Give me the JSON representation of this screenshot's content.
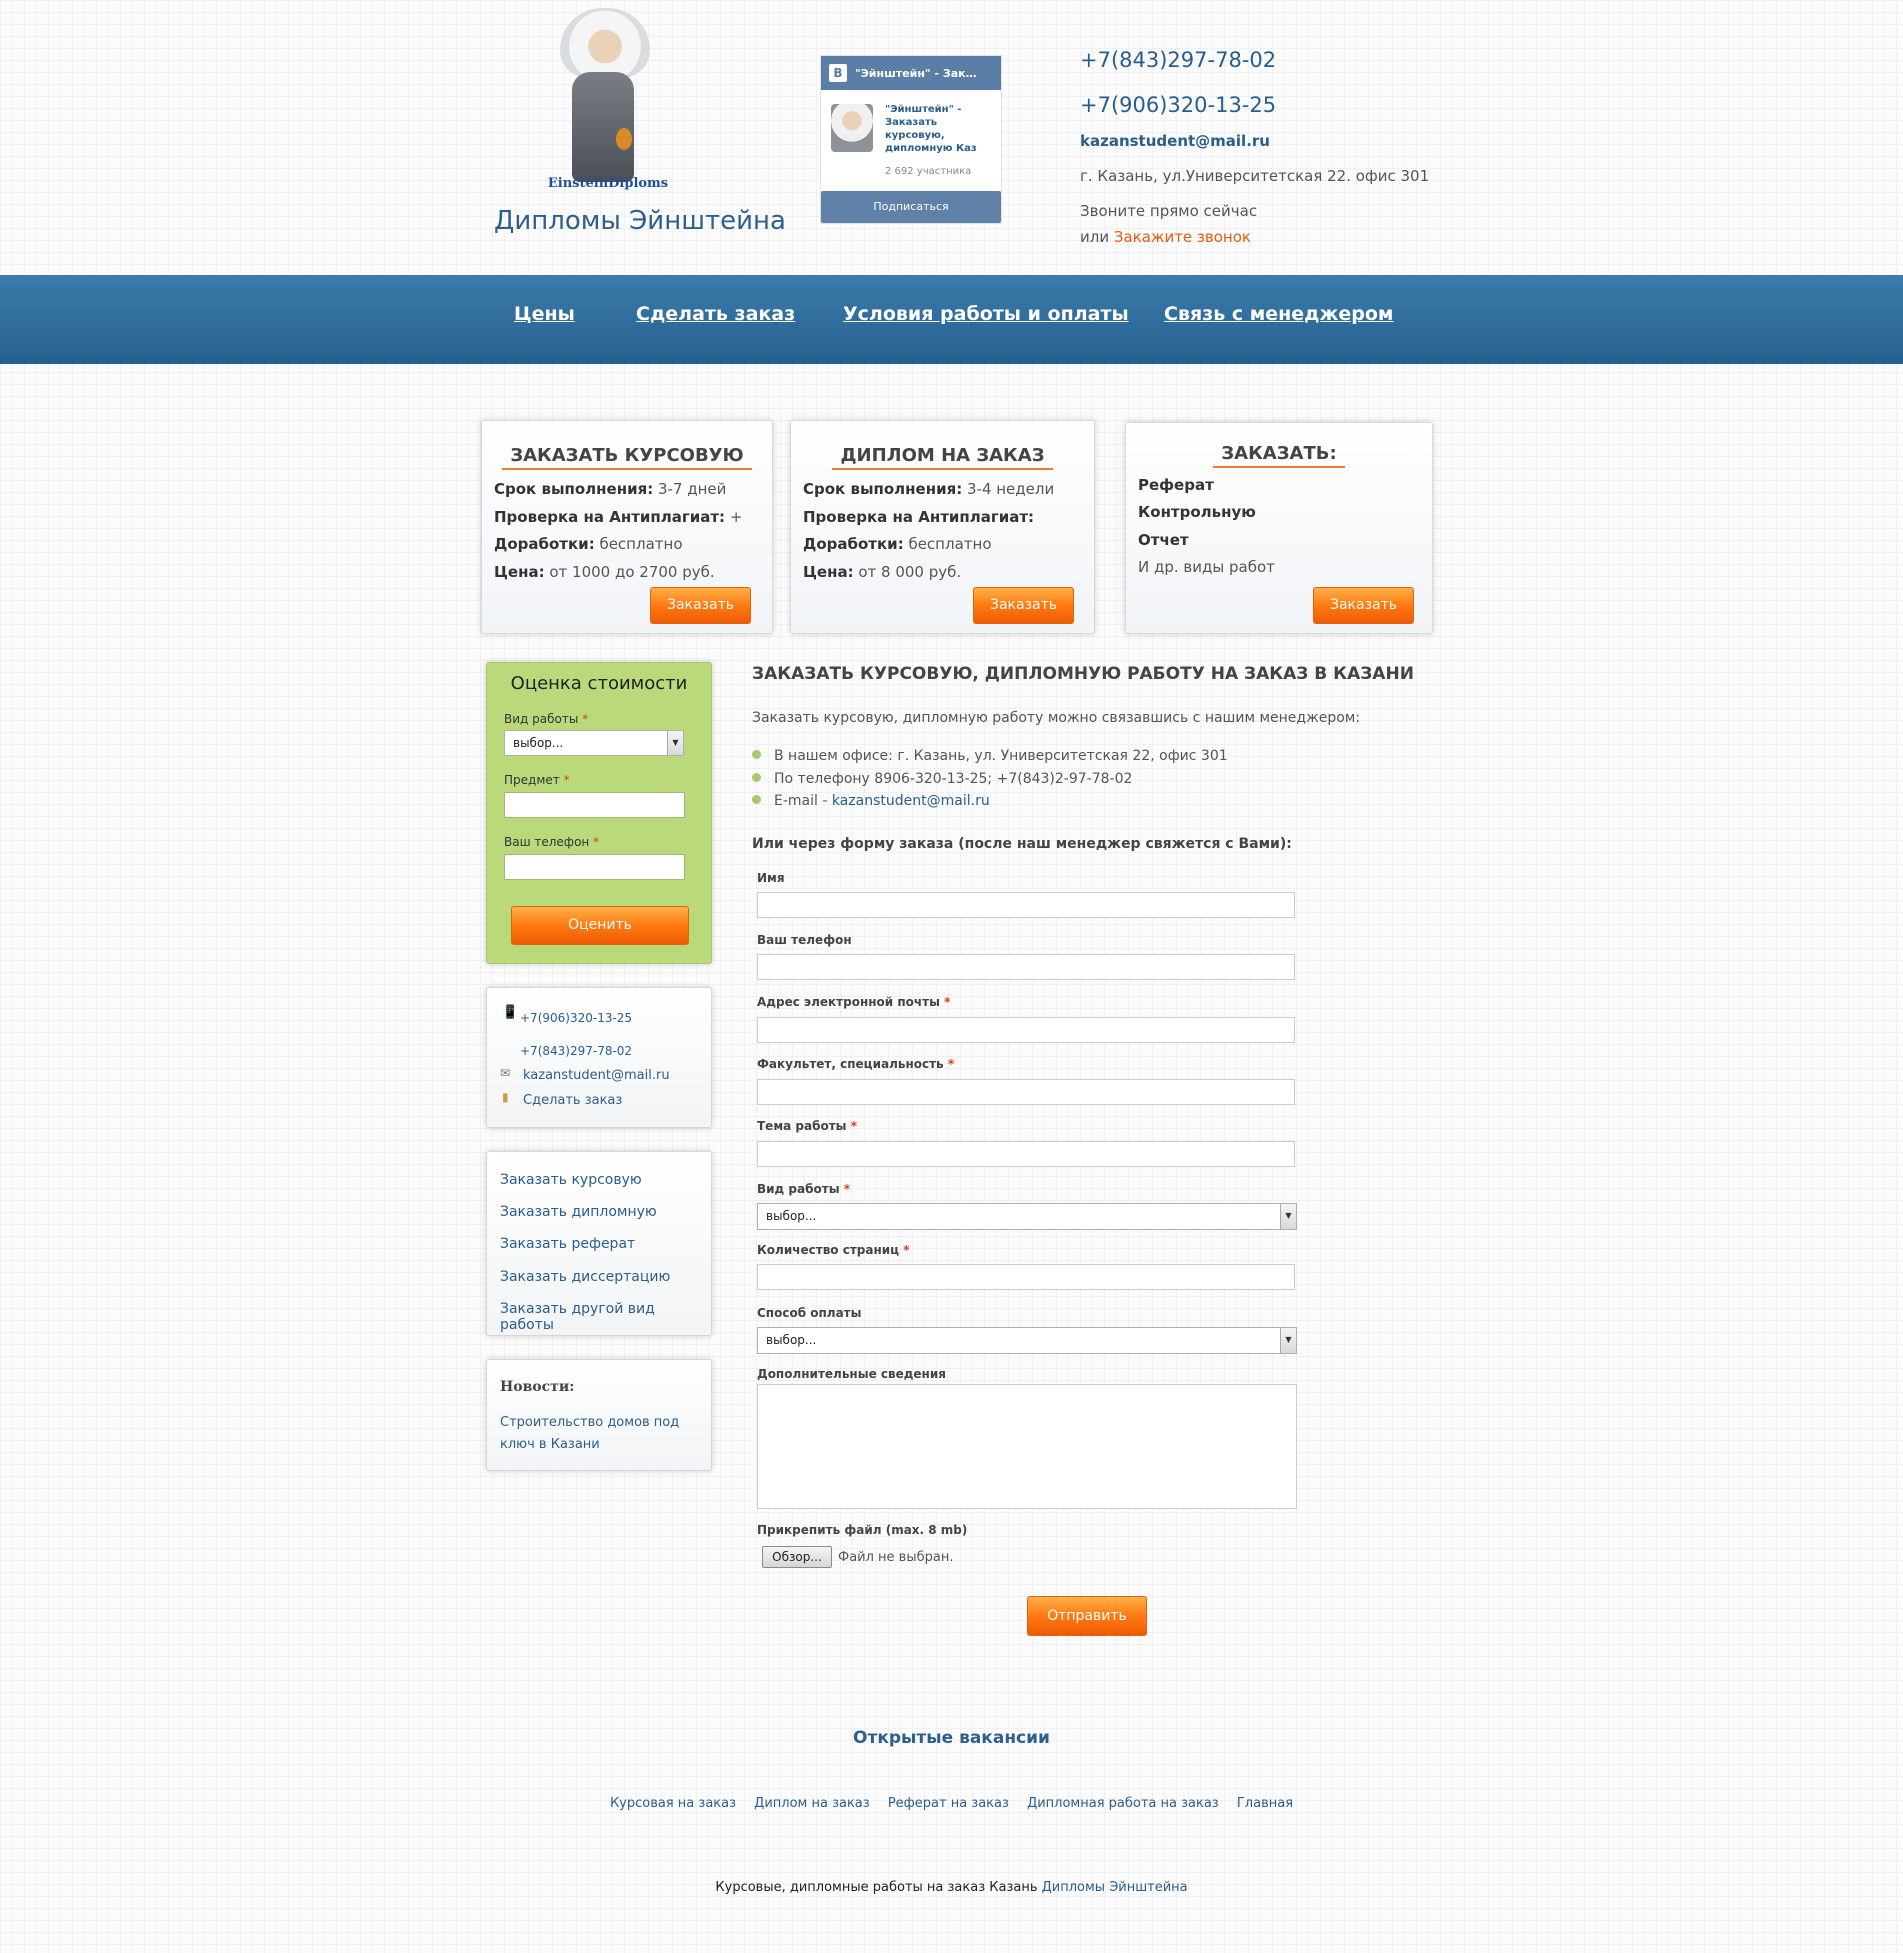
{
  "header": {
    "logo_text": "EinsteinDiploms",
    "site_title": "Дипломы Эйнштейна",
    "vk": {
      "head": "\"Эйнштейн\" - Зак…",
      "name": "\"Эйнштейн\" - Заказать курсовую, дипломную Каз",
      "count": "2 692 участника",
      "subscribe": "Подписаться"
    },
    "phone1": "+7(843)297-78-02",
    "phone2": "+7(906)320-13-25",
    "email": "kazanstudent@mail.ru",
    "address": "г. Казань, ул.Университетская 22. офис 301",
    "call_now": "Звоните прямо сейчас",
    "call_or": "или",
    "call_order": "Закажите звонок"
  },
  "nav": [
    "Цены",
    "Сделать заказ",
    "Условия работы и оплаты",
    "Связь с менеджером"
  ],
  "cards": [
    {
      "title": "ЗАКАЗАТЬ КУРСОВУЮ",
      "lines": [
        {
          "k": "Срок выполнения:",
          "v": " 3-7 дней"
        },
        {
          "k": "Проверка на Антиплагиат:",
          "v": " +"
        },
        {
          "k": "Доработки:",
          "v": " бесплатно"
        },
        {
          "k": "Цена:",
          "v": " от 1000 до 2700 руб."
        }
      ],
      "button": "Заказать"
    },
    {
      "title": "ДИПЛОМ НА ЗАКАЗ",
      "lines": [
        {
          "k": "Срок выполнения:",
          "v": " 3-4 недели"
        },
        {
          "k": "Проверка на Антиплагиат:",
          "v": ""
        },
        {
          "k": "Доработки:",
          "v": " бесплатно"
        },
        {
          "k": "Цена:",
          "v": " от 8 000 руб."
        }
      ],
      "button": "Заказать"
    },
    {
      "title": "ЗАКАЗАТЬ:",
      "items": [
        "Реферат",
        "Контрольную",
        "Отчет"
      ],
      "extra": "И др. виды работ",
      "button": "Заказать"
    }
  ],
  "calc": {
    "title": "Оценка стоимости",
    "work_type_label": "Вид работы",
    "work_type_value": "выбор...",
    "subject_label": "Предмет",
    "phone_label": "Ваш телефон",
    "button": "Оценить"
  },
  "contacts_box": {
    "phone1": "+7(906)320-13-25",
    "phone2": "+7(843)297-78-02",
    "email": "kazanstudent@mail.ru",
    "order": "Сделать заказ"
  },
  "order_links": [
    "Заказать курсовую",
    "Заказать дипломную",
    "Заказать реферат",
    "Заказать диссертацию",
    "Заказать другой вид работы"
  ],
  "news": {
    "title": "Новости:",
    "item": "Строительство домов под ключ в Казани"
  },
  "main": {
    "title": "ЗАКАЗАТЬ КУРСОВУЮ, ДИПЛОМНУЮ РАБОТУ НА ЗАКАЗ В КАЗАНИ",
    "intro": "Заказать курсовую, дипломную работу можно связавшись с нашим менеджером:",
    "bullet_office": "В нашем офисе: г. Казань, ул. Университетская 22, офис 301",
    "bullet_phone": "По телефону 8906-320-13-25; +7(843)2-97-78-02",
    "bullet_email_label": "E-mail  - ",
    "bullet_email": "kazanstudent@mail.ru",
    "form_intro": "Или через форму заказа (после наш менеджер свяжется с Вами):"
  },
  "form": {
    "name": "Имя",
    "phone": "Ваш телефон",
    "email": "Адрес электронной почты",
    "faculty": "Факультет, специальность",
    "topic": "Тема работы",
    "work_type": "Вид работы",
    "work_type_value": "выбор...",
    "pages": "Количество страниц",
    "payment": "Способ оплаты",
    "payment_value": "выбор...",
    "extra": "Дополнительные сведения",
    "attach": "Прикрепить файл (max. 8 mb)",
    "browse": "Обзор...",
    "no_file": "Файл не выбран.",
    "submit": "Отправить"
  },
  "footer": {
    "vacancies": "Открытые вакансии",
    "links": [
      "Курсовая на заказ",
      "Диплом на заказ",
      "Реферат на заказ",
      "Дипломная работа на заказ",
      "Главная"
    ],
    "copy_text": "Курсовые, дипломные работы на заказ Казань ",
    "copy_link": "Дипломы Эйнштейна"
  },
  "colors": {
    "accent_blue": "#2a5d8c",
    "nav_blue": "#2e6e9e",
    "orange": "#ff7a10",
    "green_panel": "#b9d97a"
  }
}
